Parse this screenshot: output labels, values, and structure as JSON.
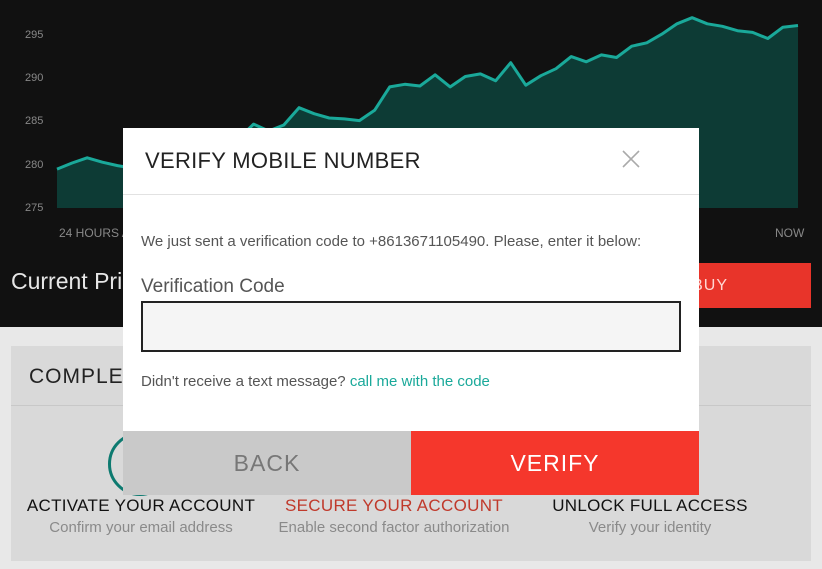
{
  "chart": {
    "y_ticks": [
      "295",
      "290",
      "285",
      "280",
      "275"
    ],
    "x_start_label": "24 HOURS A",
    "x_end_label": "NOW",
    "line_color": "#1aa99a",
    "fill_color": "#0d3b35"
  },
  "chart_data": {
    "type": "area",
    "ylim": [
      273,
      297
    ],
    "y_ticks": [
      295,
      290,
      285,
      280,
      275
    ],
    "x": [
      0,
      1,
      2,
      3,
      4,
      5,
      6,
      7,
      8,
      9,
      10,
      11,
      12,
      13,
      14,
      15,
      16,
      17,
      18,
      19,
      20,
      21,
      22,
      23,
      24,
      25,
      26,
      27,
      28,
      29,
      30,
      31,
      32,
      33,
      34,
      35,
      36,
      37,
      38,
      39,
      40,
      41,
      42,
      43,
      44,
      45,
      46,
      47,
      48,
      49
    ],
    "values": [
      279.5,
      280.2,
      280.8,
      280.3,
      279.9,
      279.6,
      280.0,
      279.4,
      279.8,
      280.5,
      281.0,
      282.4,
      283.0,
      284.7,
      283.9,
      284.6,
      286.6,
      285.9,
      285.4,
      285.3,
      285.1,
      286.3,
      289.0,
      289.3,
      289.1,
      290.4,
      289.0,
      290.2,
      290.5,
      289.7,
      291.8,
      289.2,
      290.3,
      291.1,
      292.5,
      291.9,
      292.7,
      292.4,
      293.7,
      294.1,
      295.1,
      296.3,
      297.0,
      296.3,
      296.0,
      295.5,
      295.3,
      294.6,
      295.9,
      296.1
    ]
  },
  "background": {
    "current_price_label": "Current Pri",
    "buy_label": "BUY",
    "card_title": "COMPLET",
    "steps": [
      {
        "title": "ACTIVATE YOUR ACCOUNT",
        "subtitle": "Confirm your email address"
      },
      {
        "title": "SECURE YOUR ACCOUNT",
        "subtitle": "Enable second factor authorization"
      },
      {
        "title": "UNLOCK FULL ACCESS",
        "subtitle": "Verify your identity"
      }
    ]
  },
  "modal": {
    "title": "VERIFY MOBILE NUMBER",
    "close_icon": "close-icon",
    "message": "We just sent a verification code to +8613671105490. Please, enter it below:",
    "code_label": "Verification Code",
    "code_value": "",
    "resend_prompt": "Didn't receive a text message?",
    "resend_link": "call me with the code",
    "back_label": "BACK",
    "verify_label": "VERIFY"
  },
  "colors": {
    "accent": "#1aa99a",
    "danger": "#f5372c",
    "back_button": "#c9c9c9"
  }
}
